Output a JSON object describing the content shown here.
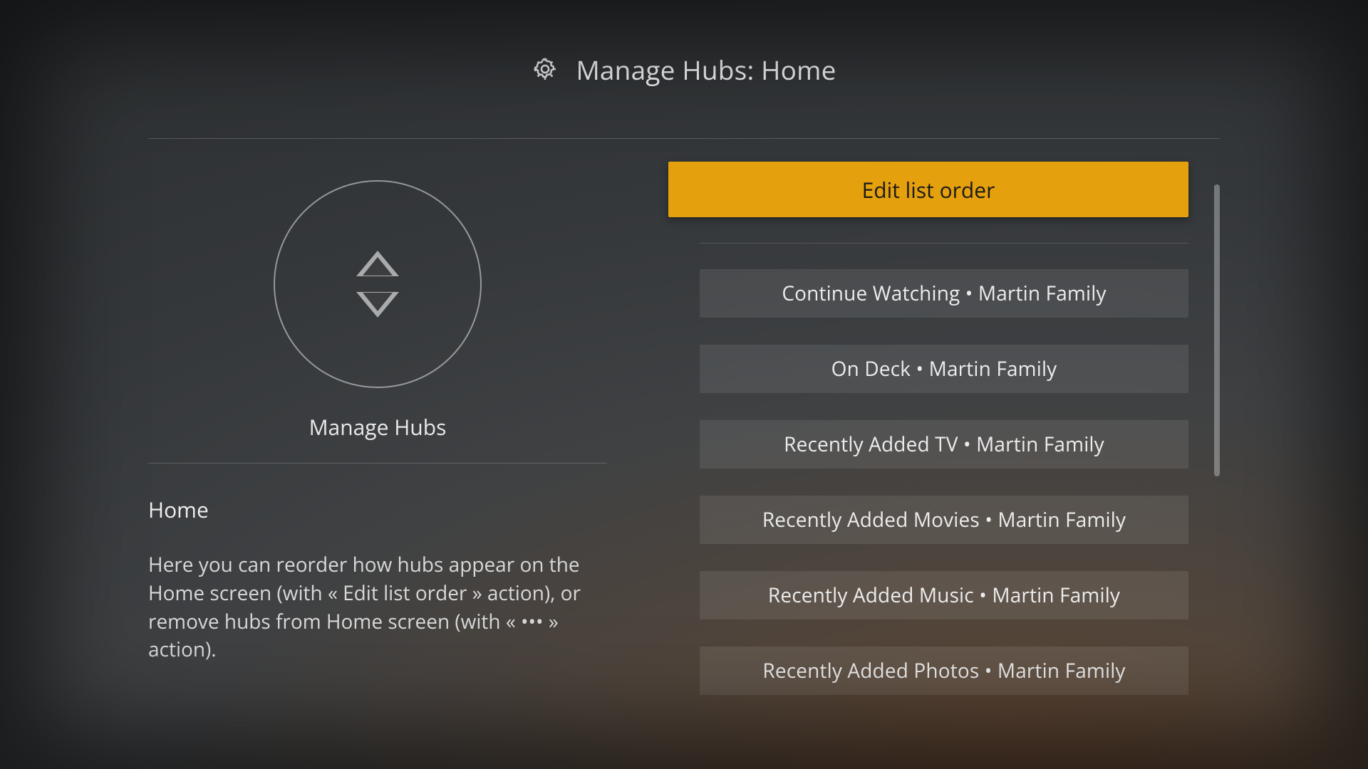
{
  "header": {
    "title": "Manage Hubs: Home"
  },
  "left_panel": {
    "badge_label": "Manage Hubs",
    "section_title": "Home",
    "description": "Here you can reorder how hubs appear on the Home screen (with « Edit list order » action), or remove hubs from Home screen (with « ••• » action)."
  },
  "right_panel": {
    "edit_button_label": "Edit list order",
    "hubs": [
      "Continue Watching • Martin Family",
      "On Deck • Martin Family",
      "Recently Added TV • Martin Family",
      "Recently Added Movies • Martin Family",
      "Recently Added Music • Martin Family",
      "Recently Added Photos • Martin Family"
    ]
  },
  "colors": {
    "accent": "#e5a00d"
  }
}
